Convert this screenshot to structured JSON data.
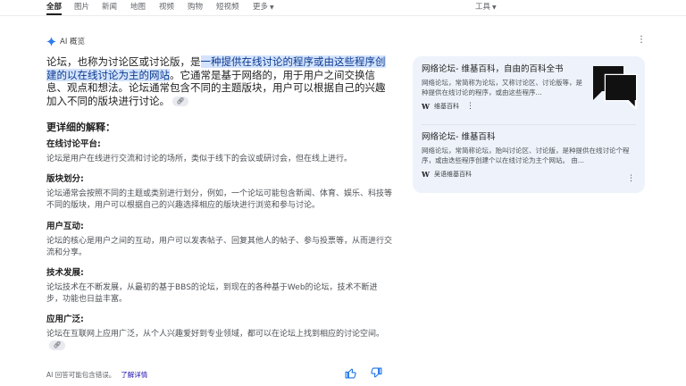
{
  "nav": {
    "tabs": [
      "全部",
      "图片",
      "新闻",
      "地图",
      "视频",
      "购物",
      "短视频",
      "更多"
    ],
    "tools": "工具"
  },
  "ai_overview": {
    "title": "AI 概览",
    "answer_part1": "论坛，也称为讨论区或讨论版，是",
    "answer_highlight": "一种提供在线讨论的程序或由这些程序创建的以在线讨论为主的网站",
    "answer_part2": "。它通常是基于网络的，用于用户之间交换信息、观点和想法。论坛通常包含不同的主题版块，用户可以根据自己的兴趣加入不同的版块进行讨论。",
    "details_heading": "更详细的解释：",
    "sections": [
      {
        "title": "在线讨论平台:",
        "body": "论坛是用户在线进行交流和讨论的场所，类似于线下的会议或研讨会，但在线上进行。"
      },
      {
        "title": "版块划分:",
        "body": "论坛通常会按照不同的主题或类别进行划分，例如，一个论坛可能包含新闻、体育、娱乐、科技等不同的版块，用户可以根据自己的兴趣选择相应的版块进行浏览和参与讨论。"
      },
      {
        "title": "用户互动:",
        "body": "论坛的核心是用户之间的互动，用户可以发表帖子、回复其他人的帖子、参与投票等，从而进行交流和分享。"
      },
      {
        "title": "技术发展:",
        "body": "论坛技术在不断发展，从最初的基于BBS的论坛，到现在的各种基于Web的论坛，技术不断进步，功能也日益丰富。"
      },
      {
        "title": "应用广泛:",
        "body": "论坛在互联网上应用广泛，从个人兴趣爱好到专业领域，都可以在论坛上找到相应的讨论空间。"
      }
    ],
    "disclaimer": "AI 回答可能包含错误。",
    "learn_more": "了解详情"
  },
  "sources": [
    {
      "title": "网络论坛- 维基百科，自由的百科全书",
      "snippet": "网络论坛，常简称为论坛，又称讨论区、讨论版等，是种提供在线讨论的程序，或由这些程序...",
      "site": "维基百科"
    },
    {
      "title": "网络论坛- 维基百科",
      "snippet": "网络论坛，常简称论坛，贻叫讨论区、讨论版，是种提供在线讨论个程序，或由迭些程序创建个以在线讨论为主个网站。 由...",
      "site": "吴语维基百科"
    }
  ],
  "colors": {
    "highlight_bg": "#d3e3fd",
    "sources_bg": "#eef3fb",
    "link": "#1a0dab"
  }
}
